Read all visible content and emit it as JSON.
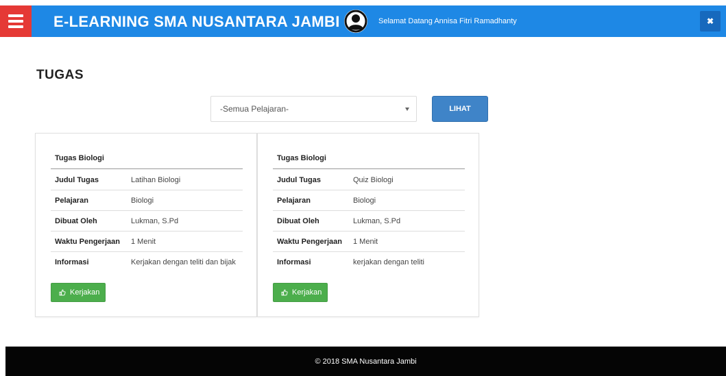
{
  "header": {
    "title": "E-LEARNING SMA NUSANTARA JAMBI",
    "welcome": "Selamat Datang Annisa Fitri Ramadhanty",
    "close_symbol": "✖",
    "colors": {
      "bar": "#1e88e5",
      "menu": "#e53935"
    }
  },
  "page": {
    "heading": "TUGAS"
  },
  "filter": {
    "selected": "-Semua Pelajaran-",
    "button_label": "LIHAT"
  },
  "cards": [
    {
      "title": "Tugas Biologi",
      "rows": [
        {
          "key": "Judul Tugas",
          "value": "Latihan Biologi"
        },
        {
          "key": "Pelajaran",
          "value": "Biologi"
        },
        {
          "key": "Dibuat Oleh",
          "value": "Lukman, S.Pd"
        },
        {
          "key": "Waktu Pengerjaan",
          "value": "1 Menit"
        },
        {
          "key": "Informasi",
          "value": "Kerjakan dengan teliti dan bijak"
        }
      ],
      "button_label": "Kerjakan",
      "button_icon": "thumbs-up-icon"
    },
    {
      "title": "Tugas Biologi",
      "rows": [
        {
          "key": "Judul Tugas",
          "value": "Quiz Biologi"
        },
        {
          "key": "Pelajaran",
          "value": "Biologi"
        },
        {
          "key": "Dibuat Oleh",
          "value": "Lukman, S.Pd"
        },
        {
          "key": "Waktu Pengerjaan",
          "value": "1 Menit"
        },
        {
          "key": "Informasi",
          "value": "kerjakan dengan teliti"
        }
      ],
      "button_label": "Kerjakan",
      "button_icon": "thumbs-up-icon"
    }
  ],
  "footer": {
    "text": "© 2018 SMA Nusantara Jambi"
  }
}
